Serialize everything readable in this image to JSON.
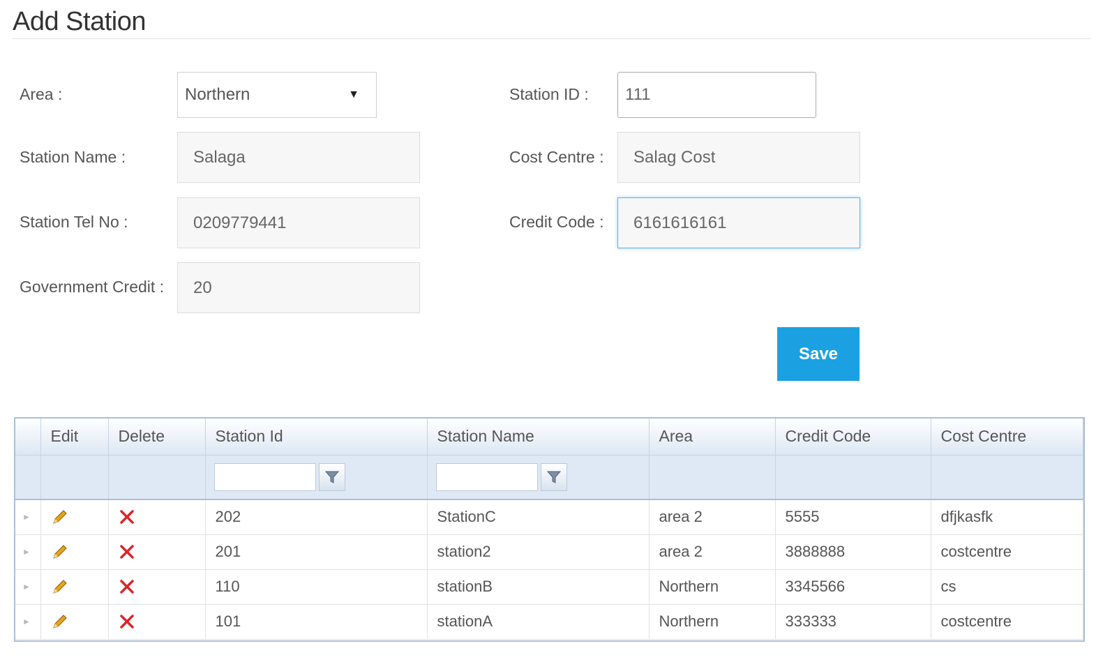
{
  "page": {
    "title": "Add Station"
  },
  "form": {
    "area_label": "Area :",
    "area_value": "Northern",
    "station_id_label": "Station ID :",
    "station_id_value": "111",
    "station_name_label": "Station Name :",
    "station_name_value": "Salaga",
    "cost_centre_label": "Cost Centre :",
    "cost_centre_value": "Salag Cost",
    "tel_label": "Station Tel No :",
    "tel_value": "0209779441",
    "credit_code_label": "Credit Code :",
    "credit_code_value": "6161616161",
    "gov_credit_label": "Government Credit :",
    "gov_credit_value": "20",
    "save_label": "Save"
  },
  "grid": {
    "columns": [
      "",
      "Edit",
      "Delete",
      "Station Id",
      "Station Name",
      "Area",
      "Credit Code",
      "Cost Centre"
    ],
    "rows": [
      {
        "station_id": "202",
        "station_name": "StationC",
        "area": "area 2",
        "credit_code": "5555",
        "cost_centre": "dfjkasfk"
      },
      {
        "station_id": "201",
        "station_name": "station2",
        "area": "area 2",
        "credit_code": "3888888",
        "cost_centre": "costcentre"
      },
      {
        "station_id": "110",
        "station_name": "stationB",
        "area": "Northern",
        "credit_code": "3345566",
        "cost_centre": "cs"
      },
      {
        "station_id": "101",
        "station_name": "stationA",
        "area": "Northern",
        "credit_code": "333333",
        "cost_centre": "costcentre"
      }
    ]
  },
  "colors": {
    "accent": "#1ba1e2",
    "grid_border": "#a9bfd6",
    "delete": "#d9262b",
    "edit": "#e8a317"
  }
}
